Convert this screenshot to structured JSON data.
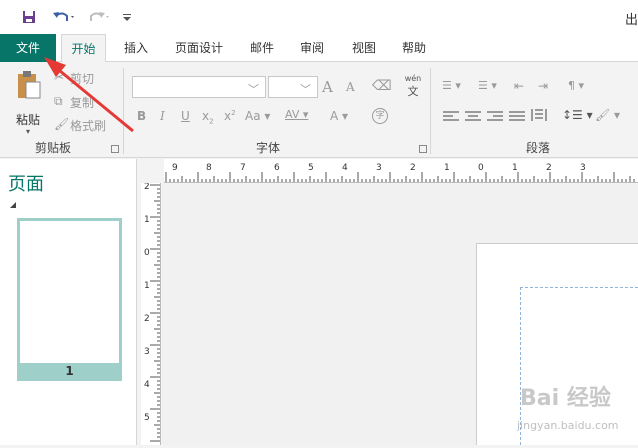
{
  "window": {
    "title": "出"
  },
  "quick_access": {
    "save_icon": "save-icon",
    "undo_icon": "undo-icon",
    "redo_icon": "redo-icon",
    "customize_icon": "customize-qat-icon"
  },
  "tabs": [
    {
      "label": "文件"
    },
    {
      "label": "开始"
    },
    {
      "label": "插入"
    },
    {
      "label": "页面设计"
    },
    {
      "label": "邮件"
    },
    {
      "label": "审阅"
    },
    {
      "label": "视图"
    },
    {
      "label": "帮助"
    }
  ],
  "clipboard": {
    "paste_label": "粘贴",
    "cut_label": "剪切",
    "copy_label": "复制",
    "format_painter_label": "格式刷",
    "group_label": "剪贴板"
  },
  "font": {
    "font_name_value": "",
    "font_size_value": "",
    "grow_label": "A",
    "shrink_label": "A",
    "bold": "B",
    "italic": "I",
    "underline": "U",
    "subscript": "x",
    "superscript": "x",
    "change_case": "Aa",
    "spacing": "AV",
    "color": "A",
    "phonetic": "wén",
    "phonetic_char": "文",
    "group_label": "字体"
  },
  "paragraph": {
    "group_label": "段落"
  },
  "pages_pane": {
    "title": "页面",
    "page_number": "1"
  },
  "ruler": {
    "h_labels": [
      "9",
      "8",
      "7",
      "6",
      "5",
      "4",
      "3",
      "2",
      "1",
      "0",
      "1",
      "2",
      "3"
    ],
    "v_labels": [
      "2",
      "1",
      "0",
      "1",
      "2",
      "3",
      "4",
      "5"
    ]
  },
  "watermark": {
    "text": "Bai  经验",
    "url": "jingyan.baidu.com"
  },
  "colors": {
    "accent": "#077568",
    "arrow": "#e53935"
  }
}
